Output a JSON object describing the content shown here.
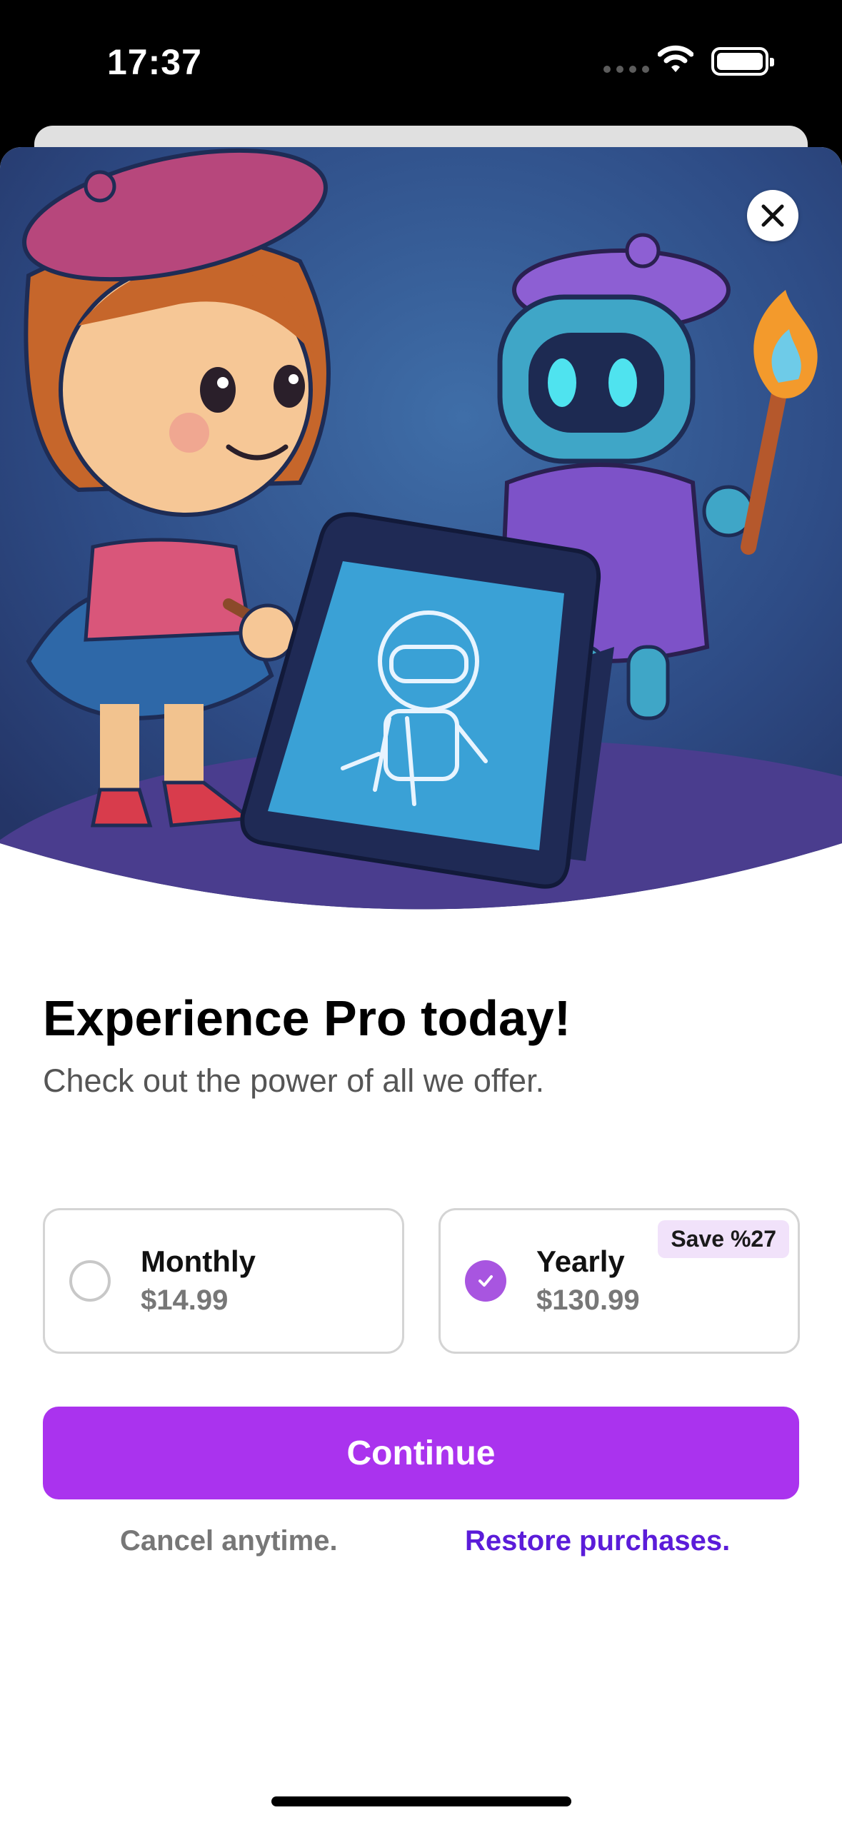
{
  "status_bar": {
    "time": "17:37"
  },
  "hero": {
    "illustration": "girl-and-robot-painting",
    "close_icon": "close-icon"
  },
  "heading": {
    "title": "Experience Pro today!",
    "subtitle": "Check out the power of all we offer."
  },
  "plans": [
    {
      "name": "Monthly",
      "price": "$14.99",
      "selected": false
    },
    {
      "name": "Yearly",
      "price": "$130.99",
      "selected": true,
      "badge": "Save %27"
    }
  ],
  "cta": {
    "label": "Continue"
  },
  "footer": {
    "cancel_text": "Cancel anytime.",
    "restore_label": "Restore purchases."
  },
  "colors": {
    "accent": "#aa33ee",
    "selected_radio": "#a855e0",
    "badge_bg": "#f1e2fa",
    "link": "#5b1cd9"
  }
}
